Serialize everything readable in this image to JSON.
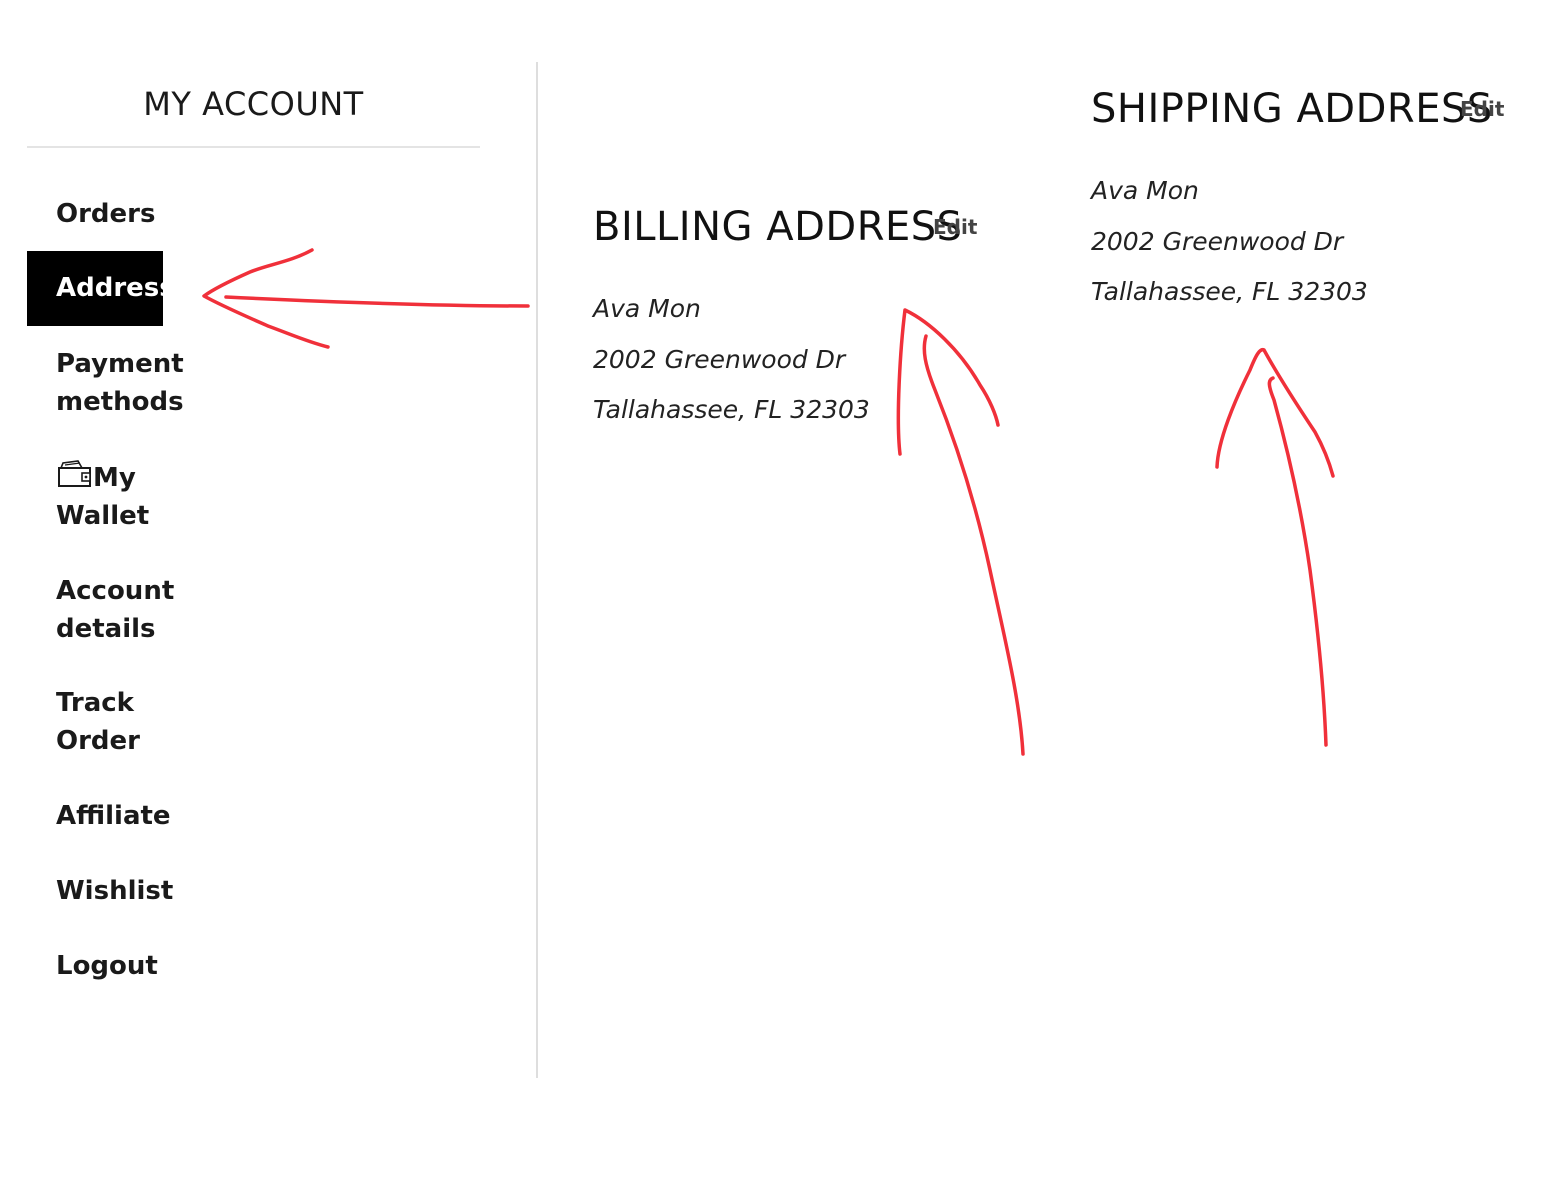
{
  "sidebar": {
    "title": "MY ACCOUNT",
    "items": [
      {
        "label": "Orders",
        "active": false
      },
      {
        "label": "Addresses",
        "active": true
      },
      {
        "label": "Payment methods",
        "active": false
      },
      {
        "label": "My Wallet",
        "icon": "wallet-icon",
        "active": false
      },
      {
        "label": "Account details",
        "active": false
      },
      {
        "label": "Track Order",
        "active": false
      },
      {
        "label": "Affiliate",
        "active": false
      },
      {
        "label": "Wishlist",
        "active": false
      },
      {
        "label": "Logout",
        "active": false
      }
    ]
  },
  "billing": {
    "heading": "BILLING ADDRESS",
    "edit_label": "Edit",
    "name": "Ava Mon",
    "street": "2002 Greenwood Dr",
    "city_line": "Tallahassee, FL 32303"
  },
  "shipping": {
    "heading": "SHIPPING ADDRESS",
    "edit_label": "Edit",
    "name": "Ava Mon",
    "street": "2002 Greenwood Dr",
    "city_line": "Tallahassee, FL 32303"
  },
  "colors": {
    "active_bg": "#000000",
    "active_text": "#ffffff",
    "annotation": "#f0303a",
    "divider": "#dedede"
  }
}
